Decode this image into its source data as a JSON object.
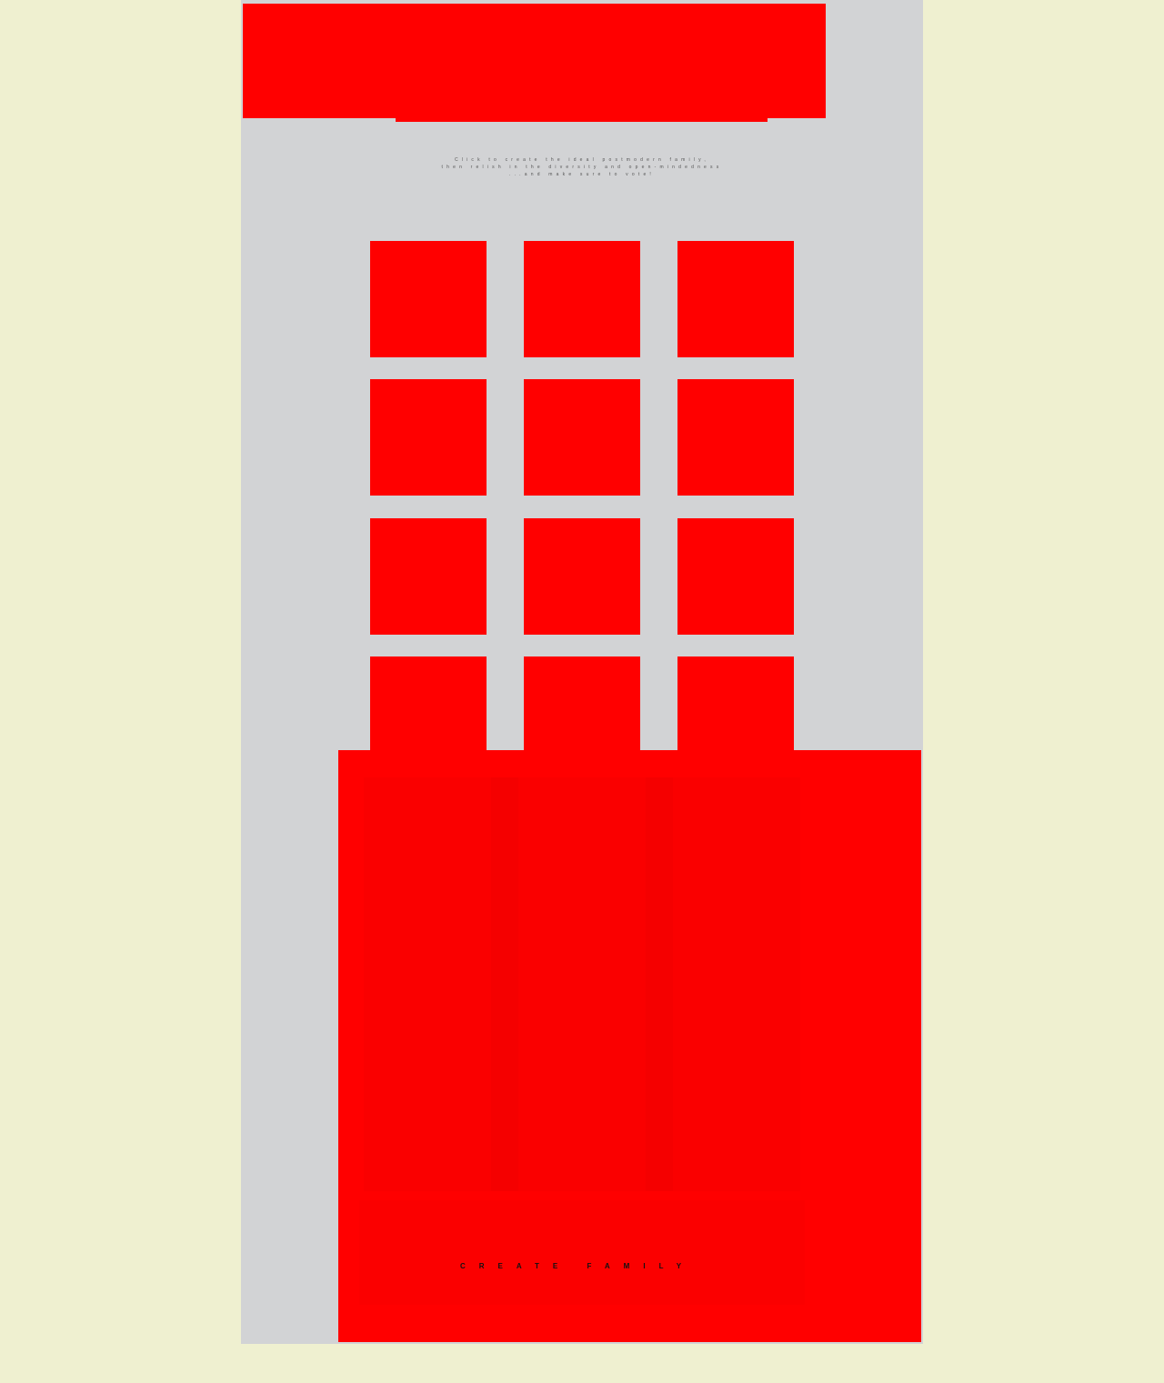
{
  "intro": {
    "line1": "Click to create the ideal postmodern family,",
    "line2": "then relish in the diversity and open-mindedness",
    "line3": "...and make sure to vote!"
  },
  "grid": {
    "tiles": [
      "tile-1",
      "tile-2",
      "tile-3",
      "tile-4",
      "tile-5",
      "tile-6",
      "tile-7",
      "tile-8",
      "tile-9",
      "tile-10",
      "tile-11",
      "tile-12"
    ]
  },
  "actions": {
    "create_label": "CREATE FAMILY"
  },
  "colors": {
    "page_background": "#eff0d0",
    "panel_background": "#d2d3d5",
    "accent_red": "#ff0000"
  }
}
